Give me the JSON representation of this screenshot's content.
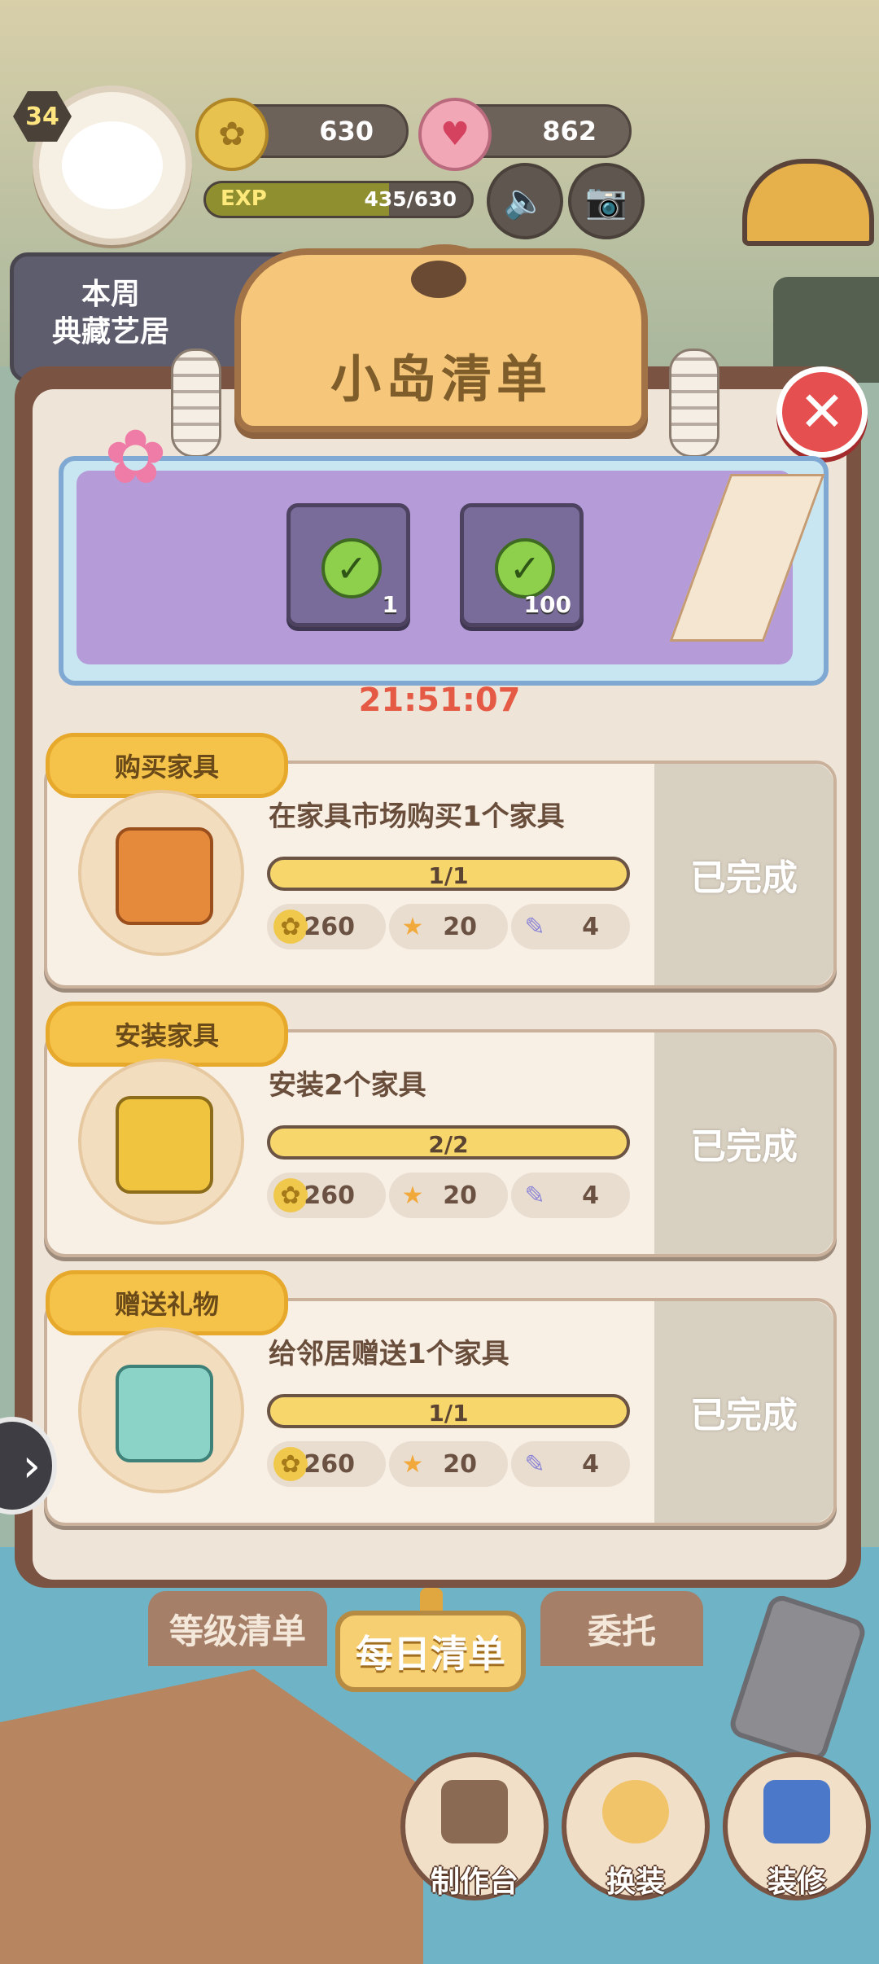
{
  "hud": {
    "level": "34",
    "coins": "630",
    "hearts": "862",
    "exp_label": "EXP",
    "exp_value": "435/630",
    "exp_progress": 0.69
  },
  "weekly_banner": {
    "line1": "本周",
    "line2": "典藏艺居"
  },
  "panel": {
    "title": "小岛清单",
    "countdown": "21:51:07",
    "rewards": [
      {
        "icon": "ticket-icon",
        "count": "1"
      },
      {
        "icon": "heart-icon",
        "count": "100"
      }
    ]
  },
  "tasks": [
    {
      "tag": "购买家具",
      "description": "在家具市场购买1个家具",
      "progress": "1/1",
      "progress_fraction": 1.0,
      "rewards": {
        "coins": "260",
        "stars": "20",
        "tickets": "4"
      },
      "status": "已完成",
      "icon": "furniture-box-icon"
    },
    {
      "tag": "安装家具",
      "description": "安装2个家具",
      "progress": "2/2",
      "progress_fraction": 1.0,
      "rewards": {
        "coins": "260",
        "stars": "20",
        "tickets": "4"
      },
      "status": "已完成",
      "icon": "tools-icon"
    },
    {
      "tag": "赠送礼物",
      "description": "给邻居赠送1个家具",
      "progress": "1/1",
      "progress_fraction": 1.0,
      "rewards": {
        "coins": "260",
        "stars": "20",
        "tickets": "4"
      },
      "status": "已完成",
      "icon": "delivery-truck-icon"
    }
  ],
  "tabs": {
    "level_list": "等级清单",
    "daily_list": "每日清单",
    "commission": "委托"
  },
  "bottom_menu": {
    "workbench": "制作台",
    "outfit": "换装",
    "decorate": "装修"
  },
  "colors": {
    "panel_border": "#7a5343",
    "accent_yellow": "#f5c24a",
    "close_red": "#e64f4f",
    "countdown_red": "#e55a44"
  }
}
